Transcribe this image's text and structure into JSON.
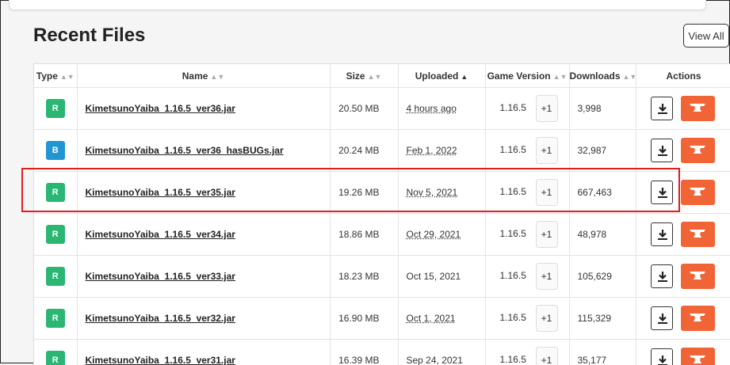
{
  "page": {
    "title": "Recent Files",
    "view_all_label": "View All"
  },
  "table": {
    "headers": {
      "type": "Type",
      "name": "Name",
      "size": "Size",
      "uploaded": "Uploaded",
      "game_version": "Game Version",
      "downloads": "Downloads",
      "actions": "Actions"
    },
    "rows": [
      {
        "type": "R",
        "name": "KimetsunoYaiba_1.16.5_ver36.jar",
        "size": "20.50 MB",
        "uploaded": "4 hours ago",
        "game_version": "1.16.5",
        "extra_versions": "+1",
        "downloads": "3,998"
      },
      {
        "type": "B",
        "name": "KimetsunoYaiba_1.16.5_ver36_hasBUGs.jar",
        "size": "20.24 MB",
        "uploaded": "Feb 1, 2022",
        "game_version": "1.16.5",
        "extra_versions": "+1",
        "downloads": "32,987"
      },
      {
        "type": "R",
        "name": "KimetsunoYaiba_1.16.5_ver35.jar",
        "size": "19.26 MB",
        "uploaded": "Nov 5, 2021",
        "game_version": "1.16.5",
        "extra_versions": "+1",
        "downloads": "667,463"
      },
      {
        "type": "R",
        "name": "KimetsunoYaiba_1.16.5_ver34.jar",
        "size": "18.86 MB",
        "uploaded": "Oct 29, 2021",
        "game_version": "1.16.5",
        "extra_versions": "+1",
        "downloads": "48,978"
      },
      {
        "type": "R",
        "name": "KimetsunoYaiba_1.16.5_ver33.jar",
        "size": "18.23 MB",
        "uploaded": "Oct 15, 2021",
        "game_version": "1.16.5",
        "extra_versions": "+1",
        "downloads": "105,629"
      },
      {
        "type": "R",
        "name": "KimetsunoYaiba_1.16.5_ver32.jar",
        "size": "16.90 MB",
        "uploaded": "Oct 1, 2021",
        "game_version": "1.16.5",
        "extra_versions": "+1",
        "downloads": "115,329"
      },
      {
        "type": "R",
        "name": "KimetsunoYaiba_1.16.5_ver31.jar",
        "size": "16.39 MB",
        "uploaded": "Sep 24, 2021",
        "game_version": "1.16.5",
        "extra_versions": "+1",
        "downloads": "35,177"
      }
    ]
  },
  "colors": {
    "release_badge": "#2bb673",
    "beta_badge": "#2196d3",
    "curseforge_button": "#f16436",
    "highlight_box": "#e21d1d"
  },
  "icons": {
    "download": "download-icon",
    "curseforge": "anvil-icon",
    "sort": "sort-icon"
  }
}
